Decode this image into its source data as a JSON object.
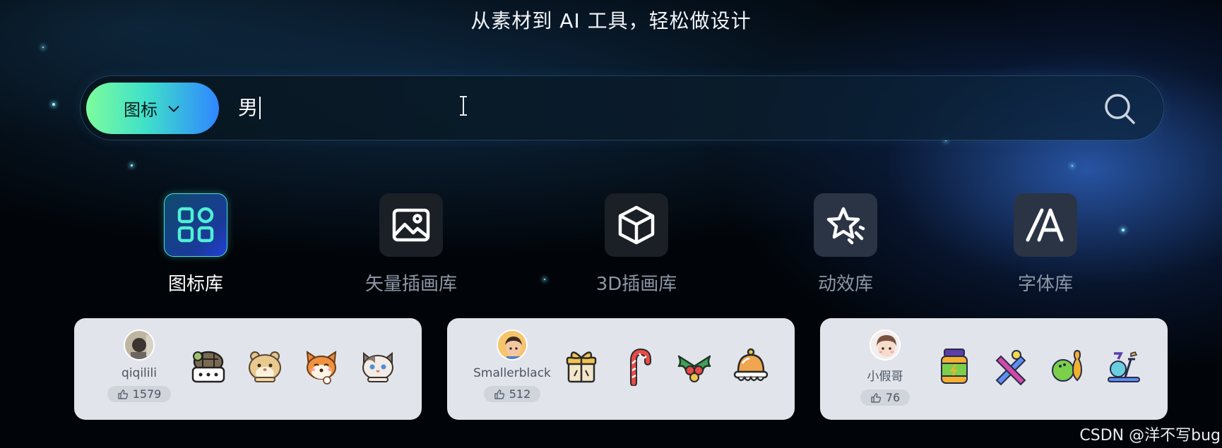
{
  "tagline": "从素材到 AI 工具，轻松做设计",
  "search": {
    "type_label": "图标",
    "query": "男"
  },
  "categories": [
    {
      "label": "图标库",
      "icon": "grid-icon",
      "active": true
    },
    {
      "label": "矢量插画库",
      "icon": "image-icon",
      "active": false
    },
    {
      "label": "3D插画库",
      "icon": "cube-icon",
      "active": false
    },
    {
      "label": "动效库",
      "icon": "sparkle-star-icon",
      "active": false
    },
    {
      "label": "字体库",
      "icon": "font-icon",
      "active": false
    }
  ],
  "cards": [
    {
      "author": "qiqilili",
      "likes": "1579",
      "icons": [
        "turtle-icon",
        "hamster-icon",
        "shiba-dog-icon",
        "cat-icon"
      ]
    },
    {
      "author": "Smallerblack",
      "likes": "512",
      "icons": [
        "gift-icon",
        "candy-cane-icon",
        "holly-icon",
        "bell-icon"
      ]
    },
    {
      "author": "小假哥",
      "likes": "76",
      "icons": [
        "supplement-jar-icon",
        "baseball-bats-icon",
        "bowling-icon",
        "exercise-bike-icon"
      ]
    }
  ],
  "colors": {
    "accent_green": "#7dfc9c",
    "accent_blue": "#2f86ff",
    "active_border": "#47e0d6"
  },
  "watermark": "CSDN @洋不写bug"
}
